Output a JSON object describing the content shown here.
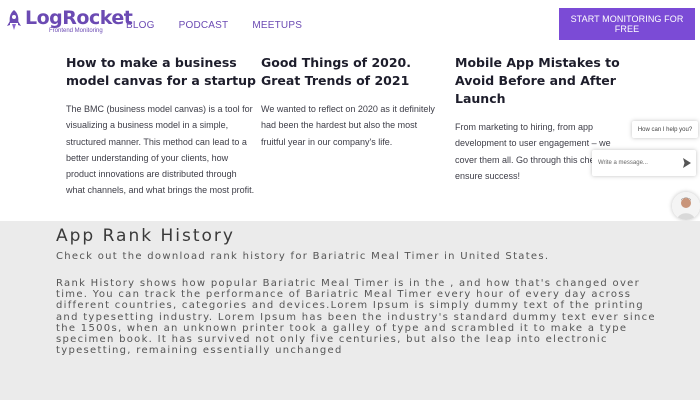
{
  "brand": {
    "name": "LogRocket",
    "tagline": "Frontend Monitoring",
    "color": "#6b4ab3"
  },
  "nav": {
    "items": [
      "BLOG",
      "PODCAST",
      "MEETUPS"
    ]
  },
  "cta": {
    "label": "START MONITORING FOR FREE",
    "color": "#7b4bd6"
  },
  "articles": [
    {
      "title": "How to make a business model canvas for a startup",
      "excerpt": "The BMC (business model canvas) is a tool for visualizing a business model in a simple, structured manner. This method can lead to a better understanding of your clients, how product innovations are distributed through what channels, and what brings the most profit."
    },
    {
      "title": "Good Things of 2020. Great Trends of 2021",
      "excerpt": "We wanted to reflect on 2020 as it definitely had been the hardest but also the most fruitful year in our company's life."
    },
    {
      "title": "Mobile App Mistakes to Avoid Before and After Launch",
      "excerpt": "From marketing to hiring, from app development to user engagement – we cover them all. Go through this check-list to ensure success!"
    }
  ],
  "chat": {
    "prompt": "How can I help you?",
    "input_placeholder": "Write a message...",
    "send_icon": "send-arrow-icon"
  },
  "rank_history": {
    "title": "App Rank History",
    "subtitle": "Check out the download rank history for Bariatric Meal Timer in United States.",
    "body": "Rank History shows how popular Bariatric Meal Timer is in the , and how that's changed over time. You can track the performance of Bariatric Meal Timer every hour of every day across different countries, categories and devices.Lorem Ipsum is simply dummy text of the printing and typesetting industry. Lorem Ipsum has been the industry's standard dummy text ever since the 1500s, when an unknown printer took a galley of type and scrambled it to make a type specimen book. It has survived not only five centuries, but also the leap into electronic typesetting, remaining essentially unchanged",
    "background": "#ebebeb"
  }
}
